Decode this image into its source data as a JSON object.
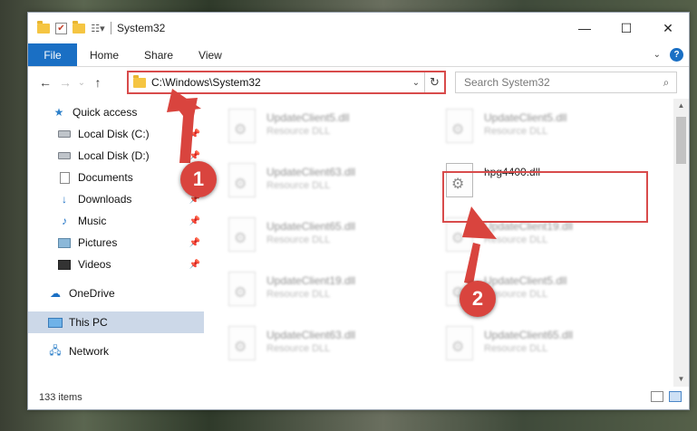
{
  "titlebar": {
    "title": "System32",
    "controls": {
      "minimize": "—",
      "maximize": "☐",
      "close": "✕"
    }
  },
  "ribbon": {
    "file_tab": "File",
    "tabs": [
      "Home",
      "Share",
      "View"
    ],
    "collapse_glyph": "⌄",
    "help_glyph": "?"
  },
  "address": {
    "path": "C:\\Windows\\System32",
    "search_placeholder": "Search System32"
  },
  "nav": {
    "back": "←",
    "forward": "→",
    "recent": "⌄",
    "up": "↑",
    "dropdown": "⌄",
    "refresh": "↻",
    "search_glyph": "⌕"
  },
  "navpane": {
    "quick_access": "Quick access",
    "items": [
      {
        "label": "Local Disk (C:)",
        "pinned": true
      },
      {
        "label": "Local Disk (D:)",
        "pinned": true
      },
      {
        "label": "Documents",
        "pinned": true
      },
      {
        "label": "Downloads",
        "pinned": true
      },
      {
        "label": "Music",
        "pinned": true
      },
      {
        "label": "Pictures",
        "pinned": true
      },
      {
        "label": "Videos",
        "pinned": true
      }
    ],
    "onedrive": "OneDrive",
    "this_pc": "This PC",
    "network": "Network"
  },
  "files": [
    {
      "name": "UpdateClient5.dll",
      "type": "Resource DLL"
    },
    {
      "name": "UpdateClient5.dll",
      "type": "Resource DLL"
    },
    {
      "name": "UpdateClient63.dll",
      "type": "Resource DLL"
    },
    {
      "name": "hpg4400.dll",
      "type": ""
    },
    {
      "name": "UpdateClient65.dll",
      "type": "Resource DLL"
    },
    {
      "name": "UpdateClient19.dll",
      "type": "Resource DLL"
    },
    {
      "name": "UpdateClient19.dll",
      "type": "Resource DLL"
    },
    {
      "name": "UpdateClient5.dll",
      "type": "Resource DLL"
    },
    {
      "name": "UpdateClient63.dll",
      "type": "Resource DLL"
    },
    {
      "name": "UpdateClient65.dll",
      "type": "Resource DLL"
    }
  ],
  "status": {
    "item_count": "133 items"
  },
  "annotations": {
    "step1": "1",
    "step2": "2",
    "color": "#d9443e"
  }
}
